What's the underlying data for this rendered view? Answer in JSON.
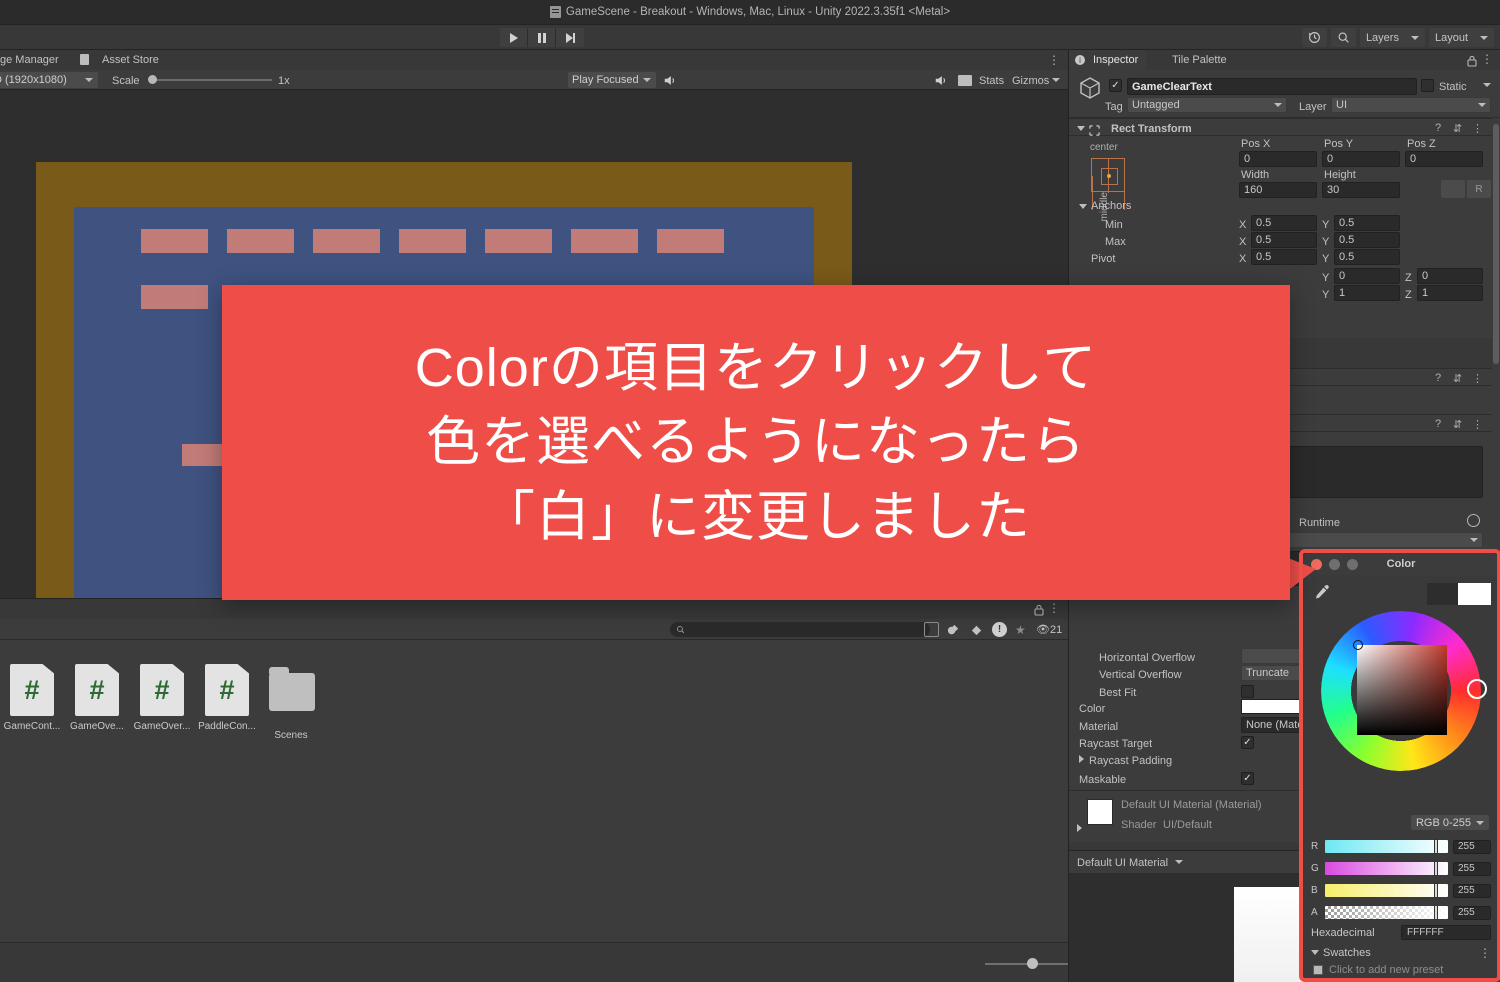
{
  "window": {
    "title": "GameScene - Breakout - Windows, Mac, Linux - Unity 2022.3.35f1 <Metal>",
    "doc_icon": "scene-file-icon"
  },
  "toolbar": {
    "play_icon": "play-icon",
    "pause_icon": "pause-icon",
    "step_icon": "step-icon",
    "history_icon": "history-icon",
    "search_icon": "search-icon",
    "layers_label": "Layers",
    "layout_label": "Layout"
  },
  "game_view": {
    "tabs": [
      {
        "label": "ge Manager",
        "icon": "package-icon",
        "active": false
      },
      {
        "label": "Asset Store",
        "icon": "assetstore-icon",
        "active": false
      }
    ],
    "aspect_label": "D (1920x1080)",
    "scale_label": "Scale",
    "scale_value": "1x",
    "play_mode_label": "Play Focused",
    "mute_icon": "mute-audio-icon",
    "stats_label": "Stats",
    "gizmos_label": "Gizmos",
    "menu_icon": "kebab-menu-icon",
    "scene": {
      "background": "#2e2e2e",
      "border_color": "#7a5a19",
      "field_color": "#3f5280",
      "brick_color": "#c27c77",
      "brick_rows": 2,
      "brick_cols": 7
    }
  },
  "project_panel": {
    "search_placeholder": "",
    "search_icon": "search-icon",
    "lock_icon": "lock-icon",
    "menu_icon": "kebab-menu-icon",
    "filter_icons": [
      "save-search-icon",
      "type-filter-icon",
      "label-filter-icon",
      "warning-filter-icon",
      "favorite-icon"
    ],
    "hidden_count": "21",
    "hidden_icon": "eye-off-icon",
    "assets": [
      {
        "name": "GameCont...",
        "type": "csharp-script"
      },
      {
        "name": "GameOve...",
        "type": "csharp-script"
      },
      {
        "name": "GameOver...",
        "type": "csharp-script"
      },
      {
        "name": "PaddleCon...",
        "type": "csharp-script"
      },
      {
        "name": "Scenes",
        "type": "folder"
      }
    ]
  },
  "inspector": {
    "tabs": [
      {
        "label": "Inspector",
        "icon": "info-icon",
        "active": true
      },
      {
        "label": "Tile Palette",
        "icon": "",
        "active": false
      }
    ],
    "lock_icon": "lock-icon",
    "menu_icon": "kebab-menu-icon",
    "object": {
      "enabled": true,
      "name": "GameClearText",
      "icon": "gameobject-icon",
      "static_label": "Static",
      "tag_label": "Tag",
      "tag_value": "Untagged",
      "layer_label": "Layer",
      "layer_value": "UI"
    },
    "rect_transform": {
      "title": "Rect Transform",
      "anchor_preset_h": "center",
      "anchor_preset_v": "middle",
      "pos_x_label": "Pos X",
      "pos_x": "0",
      "pos_y_label": "Pos Y",
      "pos_y": "0",
      "pos_z_label": "Pos Z",
      "pos_z": "0",
      "width_label": "Width",
      "width": "160",
      "height_label": "Height",
      "height": "30",
      "blueprint_icon": "blueprint-mode-icon",
      "raw_label": "R",
      "anchors_label": "Anchors",
      "min_label": "Min",
      "min_x": "0.5",
      "min_y": "0.5",
      "max_label": "Max",
      "max_x": "0.5",
      "max_y": "0.5",
      "pivot_label": "Pivot",
      "pivot_x": "0.5",
      "pivot_y": "0.5",
      "rotation_y": "0",
      "rotation_z": "0",
      "scale_y": "1",
      "scale_z": "1",
      "axis_x": "X",
      "axis_y": "Y",
      "axis_z": "Z",
      "help_icon": "help-icon",
      "preset_icon": "preset-icon"
    },
    "text_component": {
      "horizontal_overflow_label": "Horizontal Overflow",
      "vertical_overflow_label": "Vertical Overflow",
      "vertical_overflow_value": "Truncate",
      "best_fit_label": "Best Fit",
      "best_fit_checked": false,
      "color_label": "Color",
      "color_value": "#FFFFFF",
      "material_label": "Material",
      "material_value": "None (Mate",
      "raycast_target_label": "Raycast Target",
      "raycast_target_checked": true,
      "raycast_padding_label": "Raycast Padding",
      "maskable_label": "Maskable",
      "maskable_checked": true,
      "runtime_label": "Runtime"
    },
    "material_preview": {
      "title": "Default UI Material (Material)",
      "shader_label": "Shader",
      "shader_value": "UI/Default",
      "footer_label": "Default UI Material"
    }
  },
  "color_picker": {
    "title": "Color",
    "close_color": "#ef6b5e",
    "minimize_color": "#6f6f6f",
    "zoom_color": "#6f6f6f",
    "eyedropper_icon": "eyedropper-icon",
    "old_color": "#2d2d2d",
    "new_color": "#ffffff",
    "mode_label": "RGB 0-255",
    "channels": [
      {
        "name": "R",
        "value": "255"
      },
      {
        "name": "G",
        "value": "255"
      },
      {
        "name": "B",
        "value": "255"
      },
      {
        "name": "A",
        "value": "255"
      }
    ],
    "hex_label": "Hexadecimal",
    "hex_value": "FFFFFF",
    "swatches_label": "Swatches",
    "swatches_menu_icon": "kebab-menu-icon",
    "add_preset_label": "Click to add new preset"
  },
  "callout": {
    "background": "#ef4e48",
    "text_color": "#ffffff",
    "lines": [
      "Colorの項目をクリックして",
      "色を選べるようになったら",
      "「白」に変更しました"
    ]
  }
}
